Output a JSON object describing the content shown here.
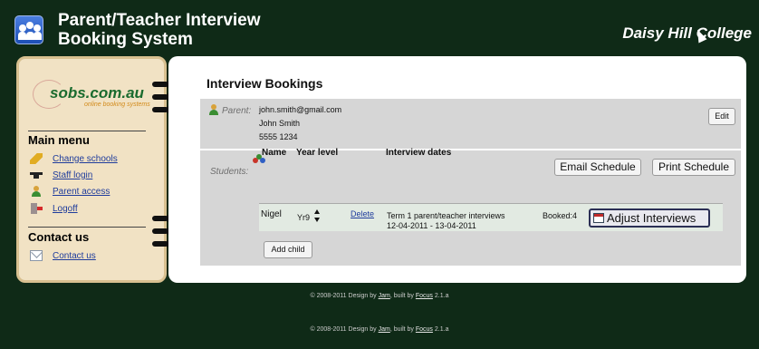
{
  "header": {
    "title_line1": "Parent/Teacher Interview",
    "title_line2": "Booking System",
    "college": "Daisy Hill College"
  },
  "sidebar": {
    "brand": "sobs.com.au",
    "brand_sub": "online booking systems",
    "main_menu_heading": "Main menu",
    "items": [
      {
        "label": "Change schools",
        "icon": "pencil-icon"
      },
      {
        "label": "Staff login",
        "icon": "graduation-cap-icon"
      },
      {
        "label": "Parent access",
        "icon": "parent-icon"
      },
      {
        "label": "Logoff",
        "icon": "logoff-icon"
      }
    ],
    "contact_heading": "Contact us",
    "contact_link": "Contact us"
  },
  "main": {
    "title": "Interview Bookings",
    "parent": {
      "label": "Parent:",
      "email": "john.smith@gmail.com",
      "name": "John Smith",
      "phone": "5555 1234",
      "edit_label": "Edit"
    },
    "students": {
      "label": "Students:",
      "email_schedule_label": "Email Schedule",
      "print_schedule_label": "Print Schedule",
      "columns": [
        "Name",
        "Year level",
        "Interview dates"
      ],
      "rows": [
        {
          "name": "Nigel",
          "year_level": "Yr9",
          "delete_label": "Delete",
          "interview_title": "Term 1 parent/teacher interviews",
          "interview_dates": "12-04-2011 - 13-04-2011",
          "booked": "Booked:4",
          "adjust_label": "Adjust Interviews"
        }
      ],
      "add_child_label": "Add child"
    }
  },
  "footer": {
    "prefix": "© 2008-2011 Design by",
    "design_link": "Jam",
    "middle": ", built by",
    "built_link": "Focus",
    "version": "2.1.a"
  }
}
